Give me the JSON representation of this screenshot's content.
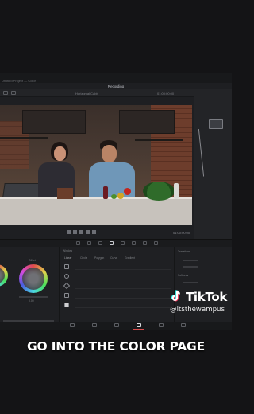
{
  "window": {
    "project_label": "Untitled Project — Color",
    "title": "Recording"
  },
  "viewer": {
    "clip_name": "Horizontal Cabb",
    "timecode_top": "01:00:00:00",
    "timecode_bottom": "01:00:00:00"
  },
  "color_panels": {
    "wheels_mode": "Offset",
    "wheel_value": "0.00",
    "window_title": "Window",
    "window_tools": [
      "Linear",
      "Circle",
      "Polygon",
      "Curve",
      "Gradient"
    ],
    "transform_title": "Transform",
    "softness_title": "Softness"
  },
  "overlay": {
    "tiktok_word": "TikTok",
    "tiktok_handle": "@itsthewampus",
    "caption": "GO INTO THE COLOR PAGE"
  },
  "colors": {
    "background": "#141416",
    "accent_red": "#d64c4c",
    "node_line": "#88898e"
  }
}
